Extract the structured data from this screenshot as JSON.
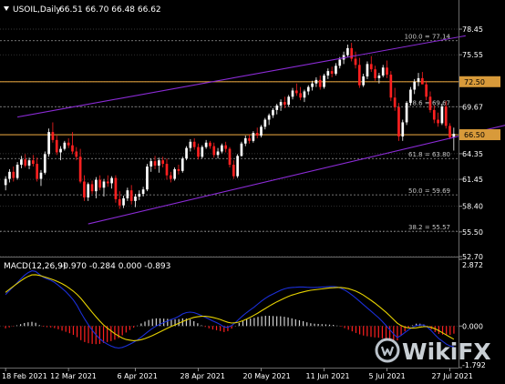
{
  "header": {
    "instrument": "USOIL,Daily",
    "ohlc": "66.51 66.70 66.48 66.62",
    "macd_label": "MACD(12,26,9)",
    "macd_values": "-0.970 -0.284 0.000 -0.893"
  },
  "colors": {
    "background": "#000000",
    "bull_candle": "#ffffff",
    "bear_candle": "#ff2020",
    "channel": "#8b2bd6",
    "horizontal": "#d89a3a",
    "grid": "#4a4a4a",
    "macd_line": "#1b2fd8",
    "signal_line": "#e6d200",
    "hist_pos": "#d0d0d0",
    "hist_neg": "#ff2020",
    "axis_text": "#ffffff"
  },
  "watermark": "WikiFX",
  "chart_data": [
    {
      "type": "candlestick",
      "title": "USOIL,Daily",
      "ylim": [
        52.7,
        80.1
      ],
      "y_ticks": [
        "78.45",
        "75.55",
        "72.50",
        "69.67",
        "66.50",
        "64.35",
        "61.45",
        "58.40",
        "55.50",
        "52.70"
      ],
      "x_ticks": [
        "18 Feb 2021",
        "12 Mar 2021",
        "6 Apr 2021",
        "28 Apr 2021",
        "20 May 2021",
        "11 Jun 2021",
        "5 Jul 2021",
        "27 Jul 2021"
      ],
      "horizontal_levels": [
        {
          "label": "72.50",
          "value": 72.5,
          "style": "solid",
          "highlight": true
        },
        {
          "label": "66.50",
          "value": 66.5,
          "style": "solid",
          "highlight": true
        }
      ],
      "fibonacci_levels": [
        {
          "label": "100.0 = 77.14",
          "value": 77.14
        },
        {
          "label": "78.6 = 69.67",
          "value": 69.67
        },
        {
          "label": "61.8 = 63.80",
          "value": 63.8
        },
        {
          "label": "50.0 = 59.69",
          "value": 59.69
        },
        {
          "label": "38.2 = 55.57",
          "value": 55.57
        }
      ],
      "channel_lines": [
        {
          "from": {
            "bar": 3,
            "price": 68.5
          },
          "to": {
            "bar": 117,
            "price": 77.7
          }
        },
        {
          "from": {
            "bar": 21,
            "price": 56.4
          },
          "to": {
            "bar": 133,
            "price": 68.2
          }
        }
      ],
      "candles": [
        [
          60.8,
          61.8,
          60.2,
          61.5
        ],
        [
          61.5,
          62.6,
          61.1,
          62.3
        ],
        [
          62.3,
          62.9,
          61.2,
          61.6
        ],
        [
          61.6,
          63.4,
          61.4,
          63.1
        ],
        [
          63.1,
          64.1,
          62.7,
          63.7
        ],
        [
          63.7,
          64.3,
          62.8,
          63.0
        ],
        [
          63.0,
          63.9,
          62.6,
          63.6
        ],
        [
          63.6,
          64.2,
          62.9,
          63.2
        ],
        [
          63.2,
          63.9,
          61.2,
          61.5
        ],
        [
          61.5,
          62.5,
          60.7,
          62.2
        ],
        [
          62.2,
          64.6,
          62.0,
          64.3
        ],
        [
          64.3,
          67.2,
          64.0,
          66.8
        ],
        [
          66.8,
          67.9,
          65.6,
          65.9
        ],
        [
          65.9,
          66.4,
          64.2,
          64.5
        ],
        [
          64.5,
          65.2,
          63.6,
          64.9
        ],
        [
          64.9,
          65.8,
          64.7,
          65.6
        ],
        [
          65.6,
          66.1,
          65.0,
          65.3
        ],
        [
          65.3,
          66.8,
          64.3,
          64.6
        ],
        [
          64.6,
          65.1,
          63.6,
          64.0
        ],
        [
          64.0,
          64.9,
          61.0,
          61.2
        ],
        [
          61.2,
          61.9,
          59.0,
          59.4
        ],
        [
          59.4,
          61.1,
          59.0,
          60.9
        ],
        [
          60.9,
          61.3,
          59.8,
          60.1
        ],
        [
          60.1,
          61.7,
          59.3,
          61.4
        ],
        [
          61.4,
          61.9,
          60.2,
          60.5
        ],
        [
          60.5,
          61.5,
          59.5,
          61.2
        ],
        [
          61.2,
          61.9,
          60.6,
          61.0
        ],
        [
          61.0,
          61.8,
          60.4,
          61.6
        ],
        [
          61.6,
          61.9,
          58.8,
          59.2
        ],
        [
          59.2,
          60.1,
          58.1,
          58.5
        ],
        [
          58.5,
          59.6,
          58.2,
          59.3
        ],
        [
          59.3,
          60.5,
          59.0,
          60.2
        ],
        [
          60.2,
          60.8,
          58.6,
          59.0
        ],
        [
          59.0,
          59.8,
          58.3,
          59.5
        ],
        [
          59.5,
          60.2,
          59.1,
          59.8
        ],
        [
          59.8,
          60.6,
          59.5,
          60.3
        ],
        [
          60.3,
          63.2,
          60.1,
          62.9
        ],
        [
          62.9,
          63.8,
          62.3,
          63.5
        ],
        [
          63.5,
          64.1,
          62.6,
          63.0
        ],
        [
          63.0,
          63.9,
          62.2,
          63.6
        ],
        [
          63.6,
          64.0,
          62.8,
          63.2
        ],
        [
          63.2,
          63.8,
          61.4,
          61.9
        ],
        [
          61.9,
          62.3,
          61.1,
          61.5
        ],
        [
          61.5,
          62.8,
          61.3,
          62.6
        ],
        [
          62.6,
          63.1,
          62.0,
          62.4
        ],
        [
          62.4,
          64.0,
          62.2,
          63.8
        ],
        [
          63.8,
          65.2,
          63.6,
          65.0
        ],
        [
          65.0,
          66.0,
          64.6,
          65.7
        ],
        [
          65.7,
          66.1,
          64.8,
          65.1
        ],
        [
          65.1,
          65.5,
          63.7,
          64.0
        ],
        [
          64.0,
          65.3,
          63.8,
          65.1
        ],
        [
          65.1,
          65.9,
          64.9,
          65.6
        ],
        [
          65.6,
          65.8,
          64.9,
          65.2
        ],
        [
          65.2,
          65.6,
          63.9,
          64.2
        ],
        [
          64.2,
          65.0,
          63.8,
          64.6
        ],
        [
          64.6,
          65.5,
          64.4,
          65.3
        ],
        [
          65.3,
          65.7,
          64.5,
          64.9
        ],
        [
          64.9,
          65.1,
          62.8,
          63.1
        ],
        [
          63.1,
          63.6,
          61.5,
          61.8
        ],
        [
          61.8,
          64.3,
          61.6,
          64.1
        ],
        [
          64.1,
          65.7,
          64.0,
          65.5
        ],
        [
          65.5,
          66.4,
          65.2,
          66.1
        ],
        [
          66.1,
          66.5,
          65.5,
          65.8
        ],
        [
          65.8,
          66.9,
          65.6,
          66.7
        ],
        [
          66.7,
          67.3,
          66.1,
          66.4
        ],
        [
          66.4,
          67.6,
          66.2,
          67.4
        ],
        [
          67.4,
          68.4,
          67.1,
          68.2
        ],
        [
          68.2,
          68.9,
          67.6,
          68.7
        ],
        [
          68.7,
          69.5,
          68.4,
          69.3
        ],
        [
          69.3,
          70.0,
          68.8,
          69.8
        ],
        [
          69.8,
          70.5,
          69.2,
          70.2
        ],
        [
          70.2,
          70.8,
          69.5,
          69.9
        ],
        [
          69.9,
          71.0,
          69.7,
          70.8
        ],
        [
          70.8,
          71.8,
          70.5,
          71.5
        ],
        [
          71.5,
          72.3,
          70.9,
          71.2
        ],
        [
          71.2,
          71.9,
          70.4,
          70.7
        ],
        [
          70.7,
          71.6,
          70.2,
          71.4
        ],
        [
          71.4,
          72.1,
          71.0,
          71.9
        ],
        [
          71.9,
          72.6,
          71.5,
          72.3
        ],
        [
          72.3,
          73.0,
          71.9,
          72.7
        ],
        [
          72.7,
          73.2,
          71.6,
          71.9
        ],
        [
          71.9,
          73.4,
          71.7,
          73.2
        ],
        [
          73.2,
          74.0,
          72.8,
          73.7
        ],
        [
          73.7,
          74.2,
          73.0,
          73.4
        ],
        [
          73.4,
          74.6,
          73.2,
          74.3
        ],
        [
          74.3,
          75.3,
          74.0,
          75.0
        ],
        [
          75.0,
          75.9,
          74.5,
          75.5
        ],
        [
          75.5,
          76.7,
          75.3,
          76.3
        ],
        [
          76.3,
          76.9,
          74.8,
          75.1
        ],
        [
          75.1,
          75.9,
          74.0,
          74.4
        ],
        [
          74.4,
          75.2,
          71.8,
          72.1
        ],
        [
          72.1,
          73.4,
          71.9,
          73.1
        ],
        [
          73.1,
          74.8,
          72.8,
          74.5
        ],
        [
          74.5,
          75.4,
          73.6,
          73.9
        ],
        [
          73.9,
          74.3,
          72.6,
          72.9
        ],
        [
          72.9,
          73.5,
          72.3,
          73.2
        ],
        [
          73.2,
          74.4,
          73.0,
          74.1
        ],
        [
          74.1,
          74.9,
          72.9,
          73.3
        ],
        [
          73.3,
          73.7,
          70.3,
          70.7
        ],
        [
          70.7,
          71.8,
          69.2,
          69.6
        ],
        [
          69.6,
          70.1,
          65.8,
          66.3
        ],
        [
          66.3,
          68.2,
          65.8,
          67.9
        ],
        [
          67.9,
          70.3,
          67.6,
          70.1
        ],
        [
          70.1,
          71.9,
          69.8,
          71.6
        ],
        [
          71.6,
          72.8,
          71.1,
          72.5
        ],
        [
          72.5,
          73.5,
          72.0,
          72.9
        ],
        [
          72.9,
          73.6,
          72.4,
          72.2
        ],
        [
          72.2,
          72.6,
          70.4,
          70.8
        ],
        [
          70.8,
          71.4,
          69.0,
          69.3
        ],
        [
          69.3,
          69.8,
          67.8,
          68.2
        ],
        [
          68.2,
          69.0,
          67.4,
          67.8
        ],
        [
          67.8,
          70.0,
          67.6,
          69.7
        ],
        [
          69.7,
          70.3,
          67.2,
          67.5
        ],
        [
          67.5,
          67.8,
          66.0,
          66.2
        ],
        [
          66.2,
          67.3,
          64.7,
          66.6
        ]
      ]
    },
    {
      "type": "line",
      "title": "MACD(12,26,9)",
      "ylim": [
        -1.792,
        2.872
      ],
      "y_ticks": [
        "2.872",
        "0.000",
        "-1.792"
      ],
      "series": [
        {
          "name": "MACD",
          "role": "macd_line",
          "values": [
            1.35,
            1.52,
            1.68,
            1.85,
            2.02,
            2.18,
            2.3,
            2.38,
            2.35,
            2.22,
            2.1,
            2.03,
            1.97,
            1.88,
            1.76,
            1.62,
            1.48,
            1.31,
            1.12,
            0.88,
            0.58,
            0.3,
            0.05,
            -0.18,
            -0.38,
            -0.55,
            -0.68,
            -0.78,
            -0.86,
            -0.92,
            -0.95,
            -0.92,
            -0.86,
            -0.78,
            -0.7,
            -0.6,
            -0.48,
            -0.35,
            -0.22,
            -0.1,
            0.0,
            0.08,
            0.15,
            0.22,
            0.28,
            0.34,
            0.42,
            0.52,
            0.58,
            0.6,
            0.58,
            0.52,
            0.45,
            0.38,
            0.3,
            0.22,
            0.15,
            0.06,
            -0.04,
            -0.06,
            0.02,
            0.15,
            0.3,
            0.45,
            0.58,
            0.7,
            0.82,
            0.95,
            1.08,
            1.2,
            1.3,
            1.38,
            1.46,
            1.54,
            1.6,
            1.64,
            1.66,
            1.67,
            1.68,
            1.68,
            1.67,
            1.66,
            1.66,
            1.67,
            1.68,
            1.69,
            1.7,
            1.7,
            1.68,
            1.63,
            1.55,
            1.45,
            1.33,
            1.2,
            1.06,
            0.92,
            0.78,
            0.64,
            0.5,
            0.36,
            0.2,
            0.02,
            -0.16,
            -0.34,
            -0.5,
            -0.4,
            -0.28,
            -0.16,
            -0.06,
            0.02,
            0.05,
            0.04,
            -0.05,
            -0.2,
            -0.38,
            -0.54,
            -0.66,
            -0.78,
            -0.86,
            -0.9
          ]
        },
        {
          "name": "Signal",
          "role": "signal_line",
          "values": [
            1.45,
            1.58,
            1.7,
            1.82,
            1.94,
            2.05,
            2.14,
            2.2,
            2.21,
            2.18,
            2.13,
            2.08,
            2.03,
            1.97,
            1.9,
            1.82,
            1.73,
            1.62,
            1.5,
            1.36,
            1.19,
            0.99,
            0.79,
            0.59,
            0.4,
            0.22,
            0.05,
            -0.09,
            -0.21,
            -0.33,
            -0.43,
            -0.52,
            -0.58,
            -0.61,
            -0.63,
            -0.62,
            -0.59,
            -0.54,
            -0.48,
            -0.41,
            -0.33,
            -0.25,
            -0.17,
            -0.09,
            -0.02,
            0.05,
            0.12,
            0.19,
            0.26,
            0.32,
            0.37,
            0.4,
            0.42,
            0.42,
            0.4,
            0.37,
            0.33,
            0.28,
            0.22,
            0.16,
            0.13,
            0.14,
            0.17,
            0.23,
            0.3,
            0.38,
            0.47,
            0.56,
            0.66,
            0.76,
            0.86,
            0.95,
            1.04,
            1.12,
            1.2,
            1.27,
            1.33,
            1.38,
            1.43,
            1.47,
            1.51,
            1.54,
            1.56,
            1.58,
            1.6,
            1.62,
            1.64,
            1.65,
            1.66,
            1.66,
            1.64,
            1.61,
            1.56,
            1.5,
            1.42,
            1.33,
            1.22,
            1.11,
            0.99,
            0.86,
            0.73,
            0.59,
            0.44,
            0.28,
            0.12,
            0.02,
            -0.05,
            -0.08,
            -0.09,
            -0.08,
            -0.05,
            -0.03,
            -0.03,
            -0.06,
            -0.12,
            -0.2,
            -0.29,
            -0.39,
            -0.48,
            -0.57
          ]
        }
      ],
      "histogram": [
        -0.1,
        -0.06,
        -0.02,
        0.03,
        0.08,
        0.13,
        0.16,
        0.18,
        0.14,
        0.04,
        -0.03,
        -0.05,
        -0.06,
        -0.09,
        -0.14,
        -0.2,
        -0.25,
        -0.31,
        -0.38,
        -0.48,
        -0.61,
        -0.69,
        -0.74,
        -0.77,
        -0.78,
        -0.77,
        -0.73,
        -0.69,
        -0.65,
        -0.59,
        -0.52,
        -0.4,
        -0.28,
        -0.17,
        -0.07,
        0.02,
        0.11,
        0.19,
        0.26,
        0.31,
        0.33,
        0.33,
        0.32,
        0.31,
        0.3,
        0.29,
        0.3,
        0.33,
        0.32,
        0.28,
        0.21,
        0.12,
        0.03,
        -0.04,
        -0.1,
        -0.15,
        -0.18,
        -0.22,
        -0.26,
        -0.22,
        -0.11,
        0.01,
        0.13,
        0.22,
        0.28,
        0.32,
        0.35,
        0.39,
        0.42,
        0.44,
        0.44,
        0.43,
        0.42,
        0.42,
        0.4,
        0.37,
        0.33,
        0.29,
        0.25,
        0.21,
        0.16,
        0.12,
        0.1,
        0.09,
        0.08,
        0.07,
        0.06,
        0.05,
        0.02,
        -0.03,
        -0.09,
        -0.16,
        -0.23,
        -0.3,
        -0.36,
        -0.41,
        -0.44,
        -0.47,
        -0.49,
        -0.5,
        -0.53,
        -0.57,
        -0.6,
        -0.62,
        -0.62,
        -0.42,
        -0.23,
        -0.08,
        0.03,
        0.1,
        0.1,
        0.07,
        -0.02,
        -0.14,
        -0.26,
        -0.34,
        -0.37,
        -0.39,
        -0.38,
        -0.33
      ]
    }
  ]
}
